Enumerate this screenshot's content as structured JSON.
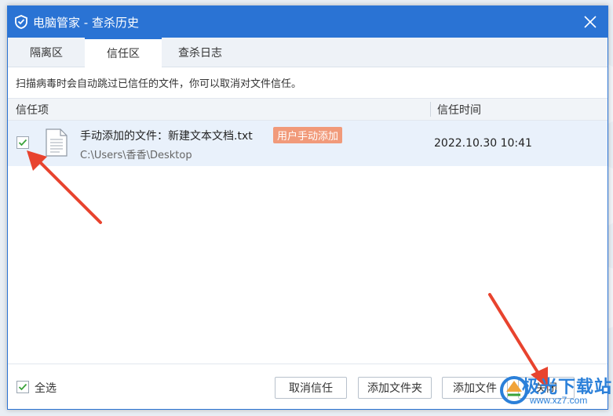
{
  "window": {
    "title": "电脑管家 - 查杀历史"
  },
  "tabs": [
    {
      "label": "隔离区",
      "active": false
    },
    {
      "label": "信任区",
      "active": true
    },
    {
      "label": "查杀日志",
      "active": false
    }
  ],
  "info": "扫描病毒时会自动跳过已信任的文件，你可以取消对文件信任。",
  "table": {
    "columns": [
      "信任项",
      "信任时间"
    ],
    "rows": [
      {
        "checked": true,
        "file_name": "手动添加的文件：新建文本文档.txt",
        "badge": "用户手动添加",
        "path": "C:\\Users\\香香\\Desktop",
        "time": "2022.10.30 10:41"
      }
    ]
  },
  "footer": {
    "select_all": "全选",
    "select_all_checked": true,
    "buttons": {
      "cancel_trust": "取消信任",
      "add_folder": "添加文件夹",
      "add_file": "添加文件",
      "close": "关闭"
    }
  },
  "watermark": {
    "main": "极光下载站",
    "sub": "www.xz7.com"
  },
  "colors": {
    "accent": "#2a73d4",
    "badge": "#f19a7a",
    "selected_row": "#e9f1fb",
    "arrow": "#e8432e",
    "check": "#3aa33a"
  }
}
